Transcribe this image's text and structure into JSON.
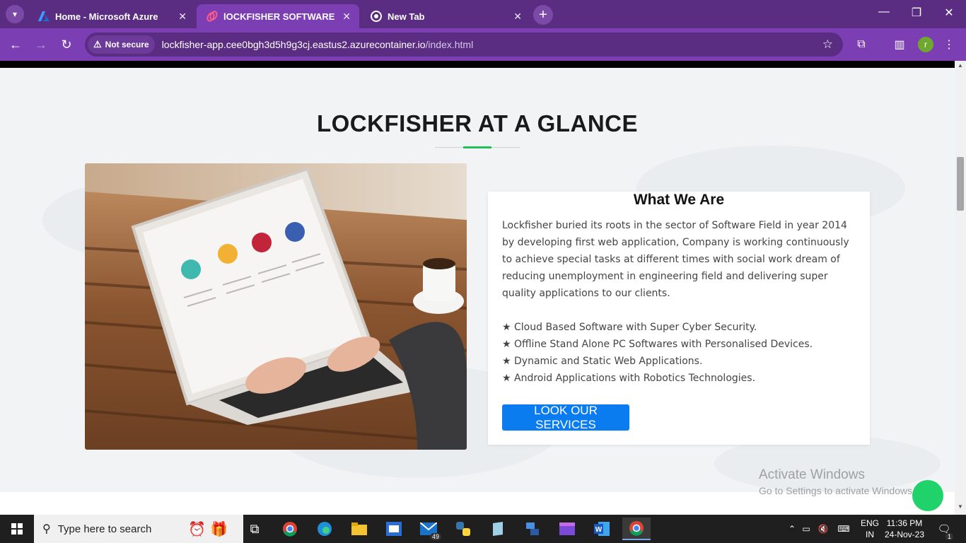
{
  "browser": {
    "tabs": [
      {
        "title": "Home - Microsoft Azure",
        "icon": "azure-icon",
        "active": false
      },
      {
        "title": "lOCKFISHER SOFTWARE TECHN",
        "icon": "lockfisher-icon",
        "active": true
      },
      {
        "title": "New Tab",
        "icon": "chrome-icon",
        "active": false
      }
    ],
    "new_tab_label": "+",
    "address": {
      "security_label": "Not secure",
      "url_host": "lockfisher-app.cee0bgh3d5h9g3cj.eastus2.azurecontainer.io",
      "url_path": "/index.html"
    },
    "profile_initial": "r"
  },
  "page": {
    "section_title": "LOCKFISHER AT A GLANCE",
    "card": {
      "title": "What We Are",
      "body": "Lockfisher buried its roots in the sector of Software Field in year 2014 by developing first web application, Company is working continuously to achieve special tasks at different times with social work dream of reducing unemployment in engineering field and delivering super quality applications to our clients.",
      "bullets": [
        "★ Cloud Based Software with Super Cyber Security.",
        "★ Offline Stand Alone PC Softwares with Personalised Devices.",
        "★ Dynamic and Static Web Applications.",
        "★ Android Applications with Robotics Technologies."
      ],
      "cta_label": "LOOK OUR SERVICES"
    },
    "watermark": {
      "line1": "Activate Windows",
      "line2": "Go to Settings to activate Windows."
    }
  },
  "taskbar": {
    "search_placeholder": "Type here to search",
    "mail_badge": "49",
    "language": {
      "line1": "ENG",
      "line2": "IN"
    },
    "time": "11:36 PM",
    "date": "24-Nov-23",
    "notification_count": "1"
  },
  "colors": {
    "tab_bar": "#5a2d82",
    "toolbar": "#7b3fb3",
    "accent_green": "#1ec15a",
    "cta_blue": "#0a7cf0"
  }
}
